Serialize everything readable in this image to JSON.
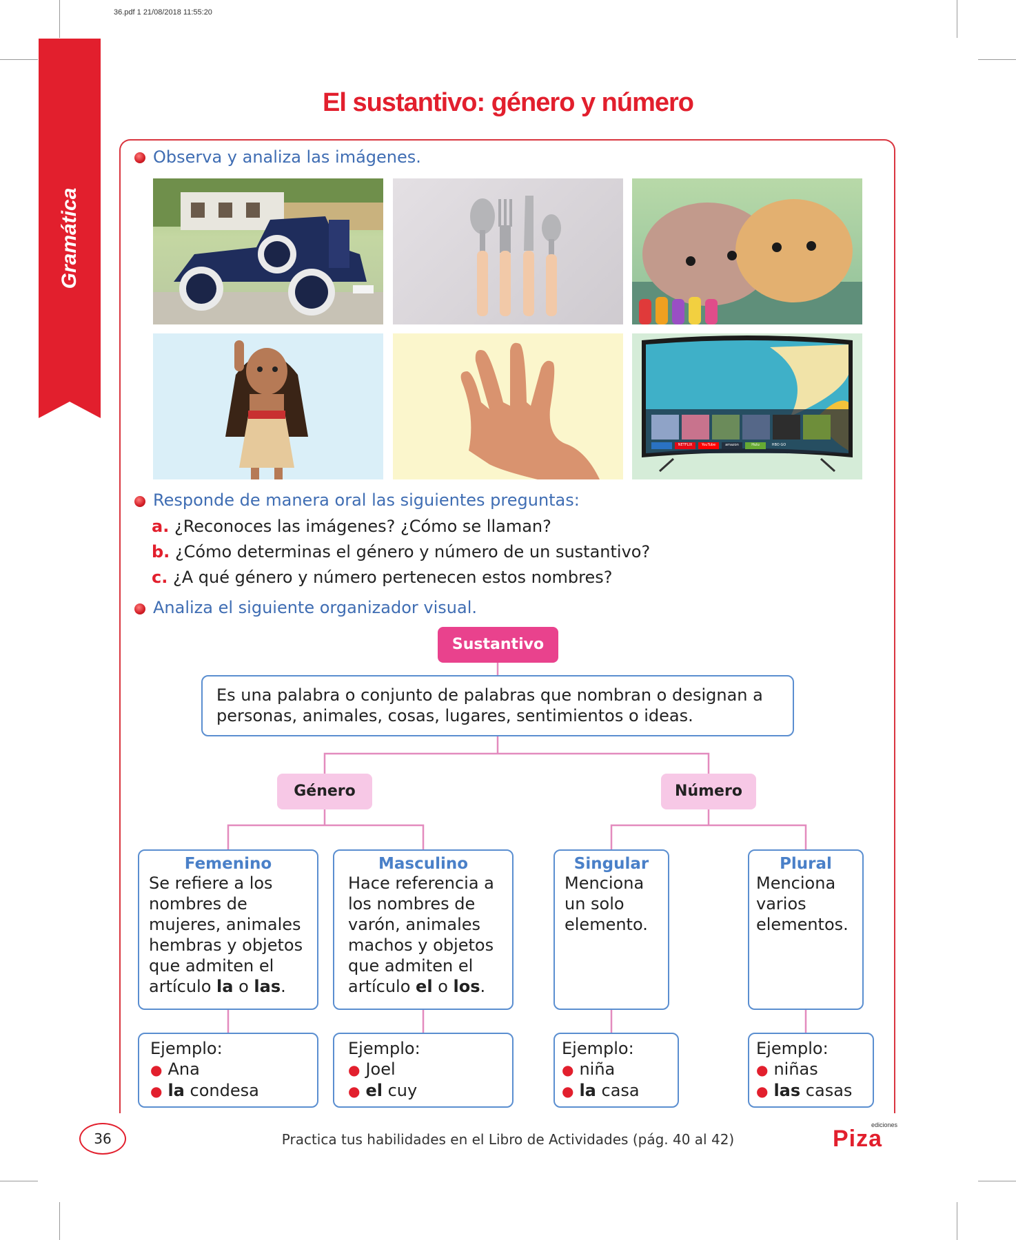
{
  "header_meta": "36.pdf  1  21/08/2018  11:55:20",
  "section_tab": "Gramática",
  "title": "El sustantivo: género y número",
  "instructions": {
    "observe": "Observa y analiza las imágenes.",
    "respond": "Responde de manera oral las siguientes preguntas:",
    "analyze": "Analiza el siguiente organizador visual."
  },
  "questions": [
    {
      "letter": "a.",
      "text": "¿Reconoces las imágenes? ¿Cómo se llaman?"
    },
    {
      "letter": "b.",
      "text": "¿Cómo determinas el género y número de un sustantivo?"
    },
    {
      "letter": "c.",
      "text": "¿A qué género y número pertenecen estos nombres?"
    }
  ],
  "photos": [
    {
      "subject": "car-icon"
    },
    {
      "subject": "cutlery-icon"
    },
    {
      "subject": "hamsters-icon"
    },
    {
      "subject": "doll-icon"
    },
    {
      "subject": "hand-icon"
    },
    {
      "subject": "tv-icon"
    }
  ],
  "tv_apps": [
    "NETFLIX",
    "YouTube",
    "amazon",
    "Hulu",
    "HBO GO"
  ],
  "organizer": {
    "root": "Sustantivo",
    "definition": "Es una palabra o conjunto de palabras que nombran o designan a personas, animales, cosas, lugares, sentimientos o ideas.",
    "genero": "Género",
    "numero": "Número",
    "femenino": {
      "title": "Femenino",
      "text_pre": "Se refiere a los nombres de mujeres, animales hembras y objetos que admiten el artículo ",
      "art1": "la",
      "mid": " o ",
      "art2": "las",
      "end": ".",
      "example_label": "Ejemplo:",
      "ex1": "Ana",
      "ex2_bold": "la",
      "ex2_rest": " condesa"
    },
    "masculino": {
      "title": "Masculino",
      "text_pre": "Hace referencia a los nombres de varón, animales machos y objetos que admiten el artículo ",
      "art1": "el",
      "mid": " o ",
      "art2": "los",
      "end": ".",
      "example_label": "Ejemplo:",
      "ex1": "Joel",
      "ex2_bold": "el",
      "ex2_rest": " cuy"
    },
    "singular": {
      "title": "Singular",
      "text": "Menciona un solo elemento.",
      "example_label": "Ejemplo:",
      "ex1": "niña",
      "ex2_bold": "la",
      "ex2_rest": " casa"
    },
    "plural": {
      "title": "Plural",
      "text": "Menciona varios elementos.",
      "example_label": "Ejemplo:",
      "ex1": "niñas",
      "ex2_bold": "las",
      "ex2_rest": " casas"
    }
  },
  "page_number": "36",
  "footer_text": "Practica tus habilidades en el Libro de Actividades (pág. 40 al 42)",
  "publisher": {
    "small": "ediciones",
    "name": "Piza"
  },
  "colors": {
    "red": "#e21f2d",
    "blue": "#3f6db3",
    "pink": "#e9428d",
    "light_pink": "#f7c8e6",
    "box_blue": "#5a8ed0"
  }
}
